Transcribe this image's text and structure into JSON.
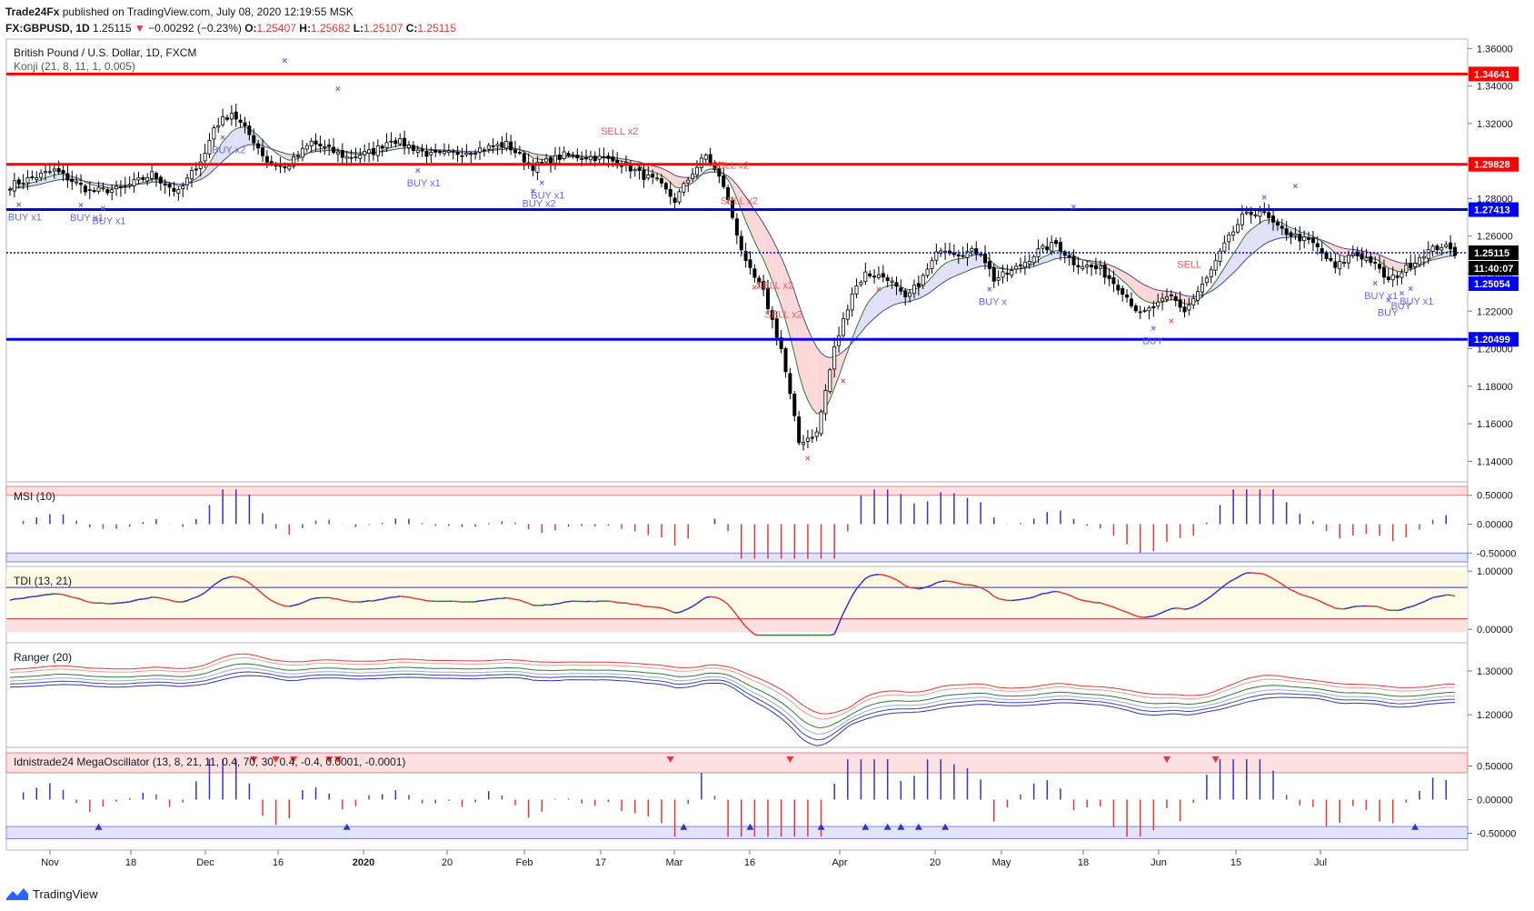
{
  "header": {
    "publisher": "Trade24Fx",
    "published_text": "published on TradingView.com, July 08, 2020 12:19:55 MSK",
    "symbol": "FX:GBPUSD, 1D",
    "last": "1.25115",
    "change": "−0.00292 (−0.23%)",
    "o_label": "O:",
    "o": "1.25407",
    "h_label": "H:",
    "h": "1.25682",
    "l_label": "L:",
    "l": "1.25107",
    "c_label": "C:",
    "c": "1.25115"
  },
  "footer": {
    "brand": "TradingView"
  },
  "colors": {
    "up": "#ffffff",
    "down": "#000000",
    "red_line": "#ff0000",
    "blue_line": "#0000ff",
    "buy": "#6666ff",
    "sell": "#ff5555"
  },
  "chart_data": [
    {
      "type": "candlestick",
      "title": "British Pound / U.S. Dollar, 1D, FXCM",
      "subtitle": "Konji (21, 8, 11, 1, 0.005)",
      "ylim": [
        1.13,
        1.365
      ],
      "y_ticks": [
        "1.36000",
        "1.34000",
        "1.32000",
        "1.30000",
        "1.28000",
        "1.26000",
        "1.24000",
        "1.22000",
        "1.20000",
        "1.18000",
        "1.16000",
        "1.14000"
      ],
      "x_ticks": [
        "Nov",
        "18",
        "Dec",
        "16",
        "2020",
        "20",
        "Feb",
        "17",
        "Mar",
        "16",
        "Apr",
        "20",
        "May",
        "18",
        "Jun",
        "15",
        "Jul"
      ],
      "horizontal_levels": [
        {
          "value": 1.34641,
          "label": "1.34641",
          "color": "red"
        },
        {
          "value": 1.29828,
          "label": "1.29828",
          "color": "red"
        },
        {
          "value": 1.27413,
          "label": "1.27413",
          "color": "blue"
        },
        {
          "value": 1.25115,
          "label": "1.25115",
          "color": "blue-dotted"
        },
        {
          "value": 1.20499,
          "label": "1.20499",
          "color": "blue"
        }
      ],
      "price_labels": [
        {
          "value": 1.25115,
          "label": "1.25115"
        },
        {
          "value": 1.2445,
          "label": "11:40:07"
        },
        {
          "value": 1.25054,
          "label": "1.25054"
        }
      ],
      "anchors": [
        [
          0,
          1.287
        ],
        [
          10,
          1.295
        ],
        [
          18,
          1.284
        ],
        [
          25,
          1.285
        ],
        [
          32,
          1.293
        ],
        [
          38,
          1.283
        ],
        [
          44,
          1.304
        ],
        [
          46,
          1.318
        ],
        [
          50,
          1.326
        ],
        [
          55,
          1.311
        ],
        [
          58,
          1.3
        ],
        [
          62,
          1.296
        ],
        [
          68,
          1.31
        ],
        [
          76,
          1.302
        ],
        [
          82,
          1.305
        ],
        [
          86,
          1.312
        ],
        [
          95,
          1.303
        ],
        [
          100,
          1.304
        ],
        [
          112,
          1.309
        ],
        [
          118,
          1.297
        ],
        [
          125,
          1.303
        ],
        [
          132,
          1.302
        ],
        [
          138,
          1.299
        ],
        [
          143,
          1.292
        ],
        [
          146,
          1.289
        ],
        [
          150,
          1.279
        ],
        [
          154,
          1.294
        ],
        [
          157,
          1.303
        ],
        [
          161,
          1.287
        ],
        [
          166,
          1.245
        ],
        [
          170,
          1.23
        ],
        [
          174,
          1.2
        ],
        [
          178,
          1.15
        ],
        [
          182,
          1.155
        ],
        [
          186,
          1.2
        ],
        [
          190,
          1.23
        ],
        [
          193,
          1.24
        ],
        [
          198,
          1.238
        ],
        [
          202,
          1.226
        ],
        [
          206,
          1.238
        ],
        [
          210,
          1.254
        ],
        [
          214,
          1.251
        ],
        [
          219,
          1.252
        ],
        [
          222,
          1.237
        ],
        [
          226,
          1.241
        ],
        [
          232,
          1.252
        ],
        [
          236,
          1.256
        ],
        [
          240,
          1.246
        ],
        [
          246,
          1.242
        ],
        [
          251,
          1.231
        ],
        [
          255,
          1.218
        ],
        [
          258,
          1.222
        ],
        [
          262,
          1.228
        ],
        [
          265,
          1.22
        ],
        [
          270,
          1.237
        ],
        [
          274,
          1.255
        ],
        [
          278,
          1.27
        ],
        [
          282,
          1.274
        ],
        [
          286,
          1.264
        ],
        [
          290,
          1.26
        ],
        [
          294,
          1.256
        ],
        [
          299,
          1.243
        ],
        [
          303,
          1.251
        ],
        [
          307,
          1.247
        ],
        [
          311,
          1.236
        ],
        [
          315,
          1.243
        ],
        [
          319,
          1.251
        ],
        [
          323,
          1.255
        ],
        [
          326,
          1.251
        ]
      ],
      "buy_signals": [
        "BUY x1",
        "BUY x1",
        "BUY x1",
        "BUY x2",
        "BUY x1",
        "BUY x2",
        "BUY x1",
        "BUY x",
        "BUY",
        "BUY x1",
        "BUY",
        "BUY",
        "BUY x1"
      ],
      "sell_signals": [
        "SELL x2",
        "SELL x2",
        "SELL x2",
        "SELL x2",
        "SELL x2",
        "SELL"
      ]
    },
    {
      "type": "bar",
      "title": "MSI (10)",
      "ylim": [
        -0.7,
        0.7
      ],
      "y_ticks": [
        "0.50000",
        "0.00000",
        "-0.50000"
      ],
      "upper_band": 0.5,
      "lower_band": -0.5
    },
    {
      "type": "line",
      "title": "TDI (13, 21)",
      "ylim": [
        -0.2,
        1.05
      ],
      "y_ticks": [
        "1.00000",
        "0.00000"
      ],
      "upper_band": 0.72,
      "lower_band": 0.18
    },
    {
      "type": "line",
      "title": "Ranger (20)",
      "ylim": [
        1.13,
        1.36
      ],
      "y_ticks": [
        "1.30000",
        "1.20000"
      ]
    },
    {
      "type": "bar",
      "title": "Idnistrade24 MegaOscillator (13, 8, 21, 11, 0.4, 70, 30, 0.4, -0.4, 0.0001, -0.0001)",
      "ylim": [
        -0.75,
        0.75
      ],
      "y_ticks": [
        "0.50000",
        "0.00000",
        "-0.50000"
      ],
      "upper_band": 0.4,
      "lower_band": -0.4
    }
  ]
}
